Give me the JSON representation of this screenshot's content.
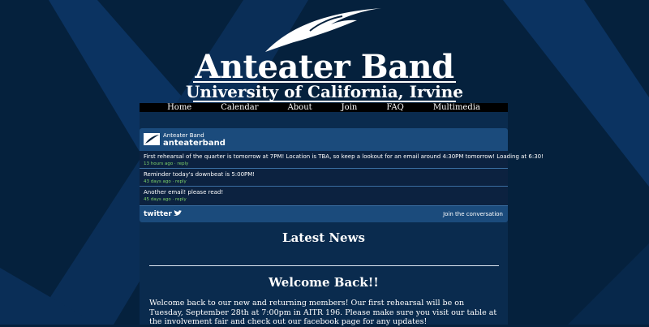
{
  "colors": {
    "background": "#05213d",
    "content_panel": "#0a2b4e",
    "twitter_bar": "#1b4b7c",
    "tweet_row": "#0c2240",
    "tweet_meta": "#7ed36a",
    "nav_bar": "#000000"
  },
  "header": {
    "title": "Anteater Band",
    "subtitle": "University of California, Irvine",
    "logo_icon": "anteater-feather-logo"
  },
  "nav": {
    "items": [
      "Home",
      "Calendar",
      "About",
      "Join",
      "FAQ",
      "Multimedia"
    ]
  },
  "twitter": {
    "name": "Anteater Band",
    "handle": "anteaterband",
    "tweets": [
      {
        "text": "First rehearsal of the quarter is tomorrow at 7PM! Location is TBA, so keep a lookout for an email around 4:30PM tomorrow! Loading at 6:30!",
        "meta": "13 hours ago · reply"
      },
      {
        "text": "Reminder today's downbeat is 5:00PM!",
        "meta": "43 days ago · reply"
      },
      {
        "text": "Another email! please read!",
        "meta": "45 days ago · reply"
      }
    ],
    "logo_text": "twitter",
    "join_label": "Join the conversation"
  },
  "news": {
    "heading": "Latest News",
    "post_title": "Welcome Back!!",
    "post_body": "Welcome back to our new and returning members! Our first rehearsal will be on Tuesday, September 28th at 7:00pm in AITR 196. Please make sure you visit our table at the involvement fair and check out our facebook page for any updates!"
  }
}
